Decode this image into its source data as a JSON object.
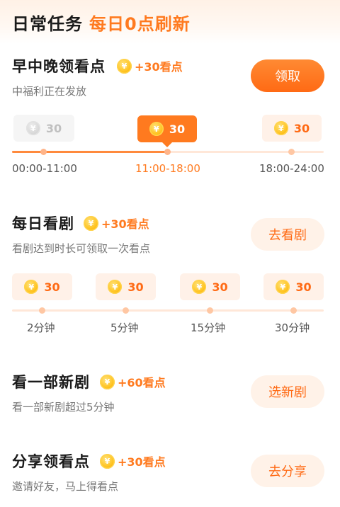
{
  "header": {
    "title": "日常任务",
    "subtitle": "每日0点刷新"
  },
  "colors": {
    "accent": "#ff7a1f",
    "pill_done_bg": "#f5f5f5",
    "pill_future_bg": "#fff1e8"
  },
  "tasks": [
    {
      "title": "早中晚领看点",
      "reward": "+30看点",
      "desc": "中福利正在发放",
      "button": "领取",
      "button_state": "primary",
      "milestones": [
        {
          "value": "30",
          "label": "00:00-11:00",
          "state": "done"
        },
        {
          "value": "30",
          "label": "11:00-18:00",
          "state": "current"
        },
        {
          "value": "30",
          "label": "18:00-24:00",
          "state": "future"
        }
      ],
      "progress_fraction": 0.5
    },
    {
      "title": "每日看剧",
      "reward": "+30看点",
      "desc": "看剧达到时长可领取一次看点",
      "button": "去看剧",
      "button_state": "secondary",
      "milestones": [
        {
          "value": "30",
          "label": "2分钟",
          "state": "future"
        },
        {
          "value": "30",
          "label": "5分钟",
          "state": "future"
        },
        {
          "value": "30",
          "label": "15分钟",
          "state": "future"
        },
        {
          "value": "30",
          "label": "30分钟",
          "state": "future"
        }
      ],
      "progress_fraction": 0
    },
    {
      "title": "看一部新剧",
      "reward": "+60看点",
      "desc": "看一部新剧超过5分钟",
      "button": "选新剧",
      "button_state": "secondary"
    },
    {
      "title": "分享领看点",
      "reward": "+30看点",
      "desc": "邀请好友，马上得看点",
      "button": "去分享",
      "button_state": "secondary"
    }
  ],
  "coin_icon": "yen-coin-icon",
  "coin_glyph": "¥"
}
